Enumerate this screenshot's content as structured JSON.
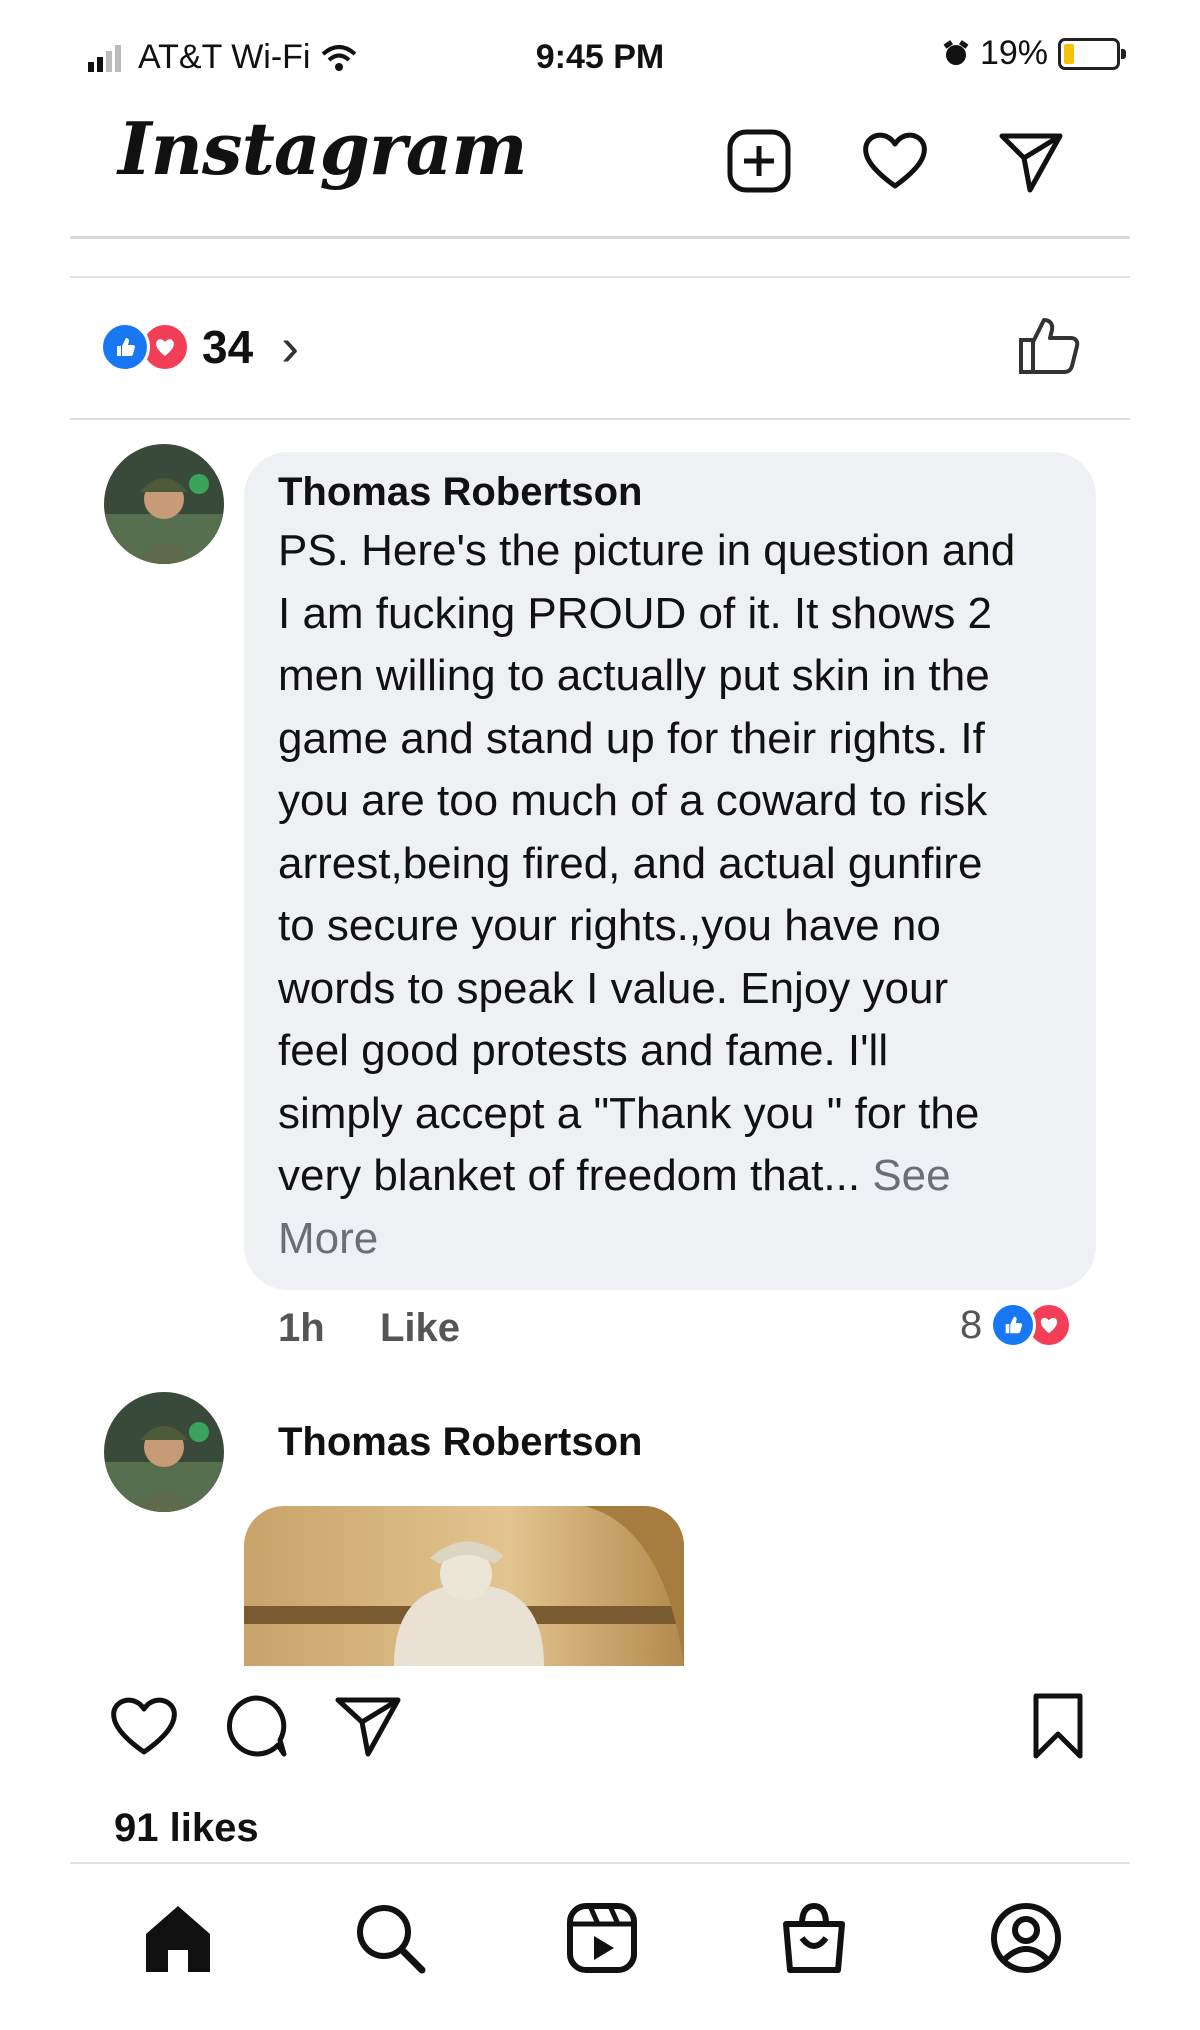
{
  "status_bar": {
    "carrier": "AT&T Wi-Fi",
    "time": "9:45 PM",
    "battery": "19%"
  },
  "header": {
    "logo": "Instagram",
    "icons": [
      "new-post-icon",
      "heart-icon",
      "direct-message-icon"
    ]
  },
  "reactions": {
    "count": "34",
    "types": [
      "like",
      "love"
    ],
    "colors": {
      "like": "#1877f2",
      "love": "#f33e58"
    }
  },
  "comment": {
    "author": "Thomas Robertson",
    "lines": [
      "PS. Here's the picture in question and",
      "I am fucking PROUD of it. It shows 2",
      "men willing to actually put skin in the",
      "game and stand up for their rights. If",
      "you are too much of a coward to risk",
      "arrest,being fired, and actual gunfire",
      "to secure your rights.,you have no",
      "words to speak I value. Enjoy your",
      "feel good protests and fame. I'll",
      "simply accept a \"Thank you \" for the",
      "very blanket of freedom that..."
    ],
    "see": "See",
    "more": "More",
    "time": "1h",
    "like_label": "Like",
    "reaction_count": "8"
  },
  "reply": {
    "author": "Thomas Robertson"
  },
  "post_actions": {
    "likes": "91 likes"
  },
  "bottom_nav": [
    "home-icon",
    "search-icon",
    "reels-icon",
    "shop-icon",
    "profile-icon"
  ]
}
